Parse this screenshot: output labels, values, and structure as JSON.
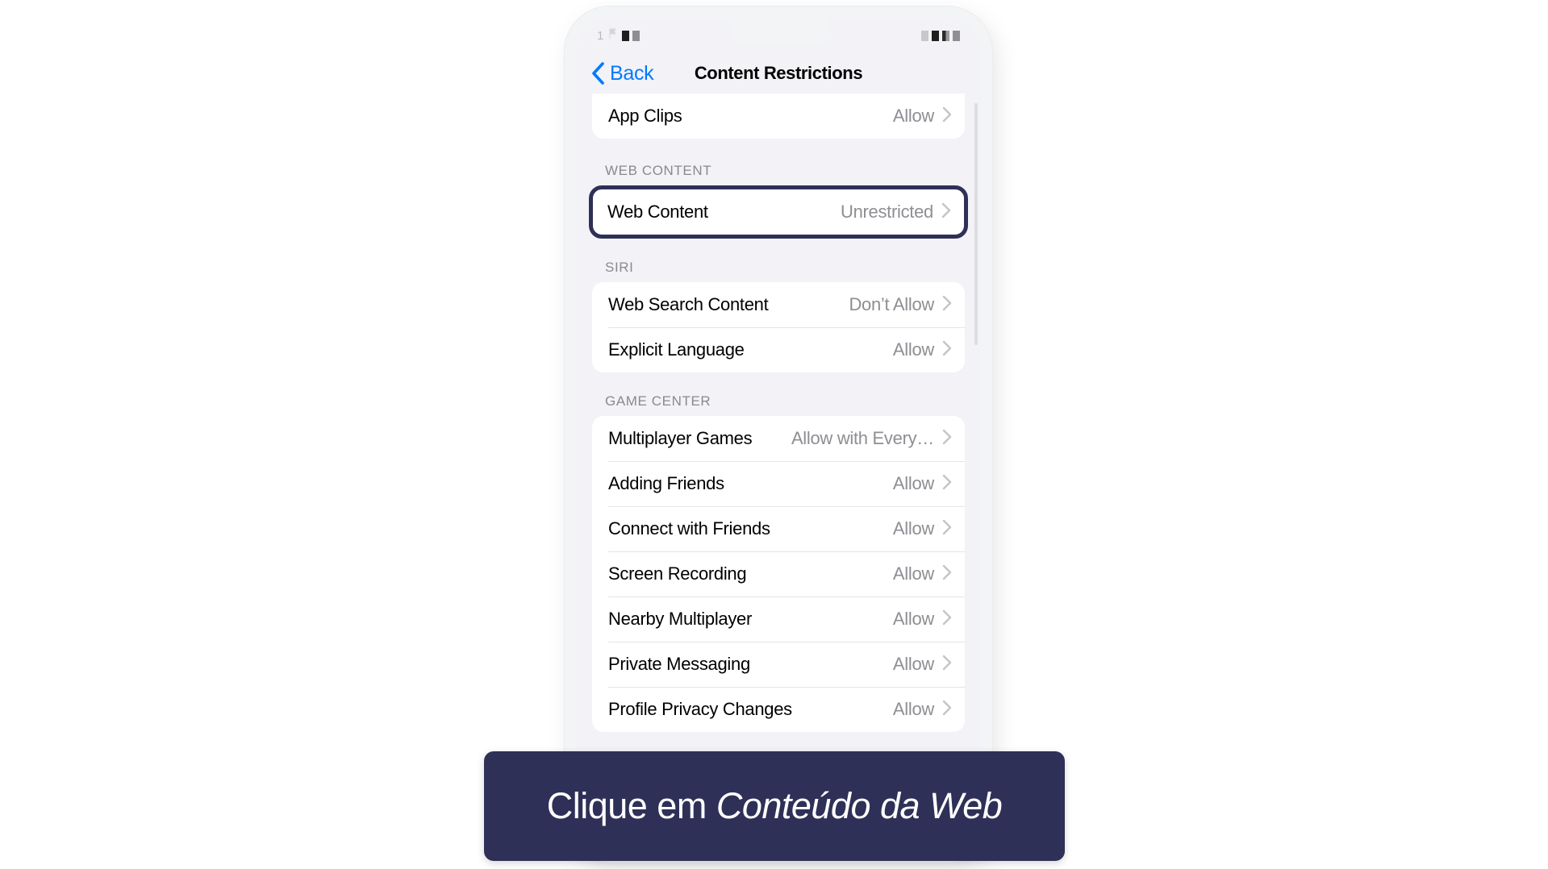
{
  "app": {
    "platform": "ios-settings",
    "accent_color": "#007aff",
    "highlight_color": "#2f3057",
    "screen_background": "#f2f2f7",
    "card_background": "#ffffff",
    "secondary_text_color": "#8e8e93"
  },
  "status_bar": {
    "left_text": "1",
    "left_icons": [
      "flag-icon",
      "pixelated-icon",
      "pixelated-icon"
    ],
    "right_icons": [
      "pixelated-icon",
      "pixelated-icon",
      "pixelated-icon"
    ],
    "obscured": "true"
  },
  "nav": {
    "back_label": "Back",
    "title": "Content Restrictions",
    "back_icon": "chevron-left-icon"
  },
  "sections": [
    {
      "header": "",
      "clipped_top": true,
      "rows": [
        {
          "label": "App Clips",
          "value": "Allow",
          "accessory": "chevron-right-icon"
        }
      ]
    },
    {
      "header": "WEB CONTENT",
      "highlighted": true,
      "rows": [
        {
          "label": "Web Content",
          "value": "Unrestricted",
          "accessory": "chevron-right-icon"
        }
      ]
    },
    {
      "header": "SIRI",
      "rows": [
        {
          "label": "Web Search Content",
          "value": "Don’t Allow",
          "accessory": "chevron-right-icon"
        },
        {
          "label": "Explicit Language",
          "value": "Allow",
          "accessory": "chevron-right-icon"
        }
      ]
    },
    {
      "header": "GAME CENTER",
      "rows": [
        {
          "label": "Multiplayer Games",
          "value": "Allow with Every…",
          "accessory": "chevron-right-icon"
        },
        {
          "label": "Adding Friends",
          "value": "Allow",
          "accessory": "chevron-right-icon"
        },
        {
          "label": "Connect with Friends",
          "value": "Allow",
          "accessory": "chevron-right-icon"
        },
        {
          "label": "Screen Recording",
          "value": "Allow",
          "accessory": "chevron-right-icon"
        },
        {
          "label": "Nearby Multiplayer",
          "value": "Allow",
          "accessory": "chevron-right-icon"
        },
        {
          "label": "Private Messaging",
          "value": "Allow",
          "accessory": "chevron-right-icon"
        },
        {
          "label": "Profile Privacy Changes",
          "value": "Allow",
          "accessory": "chevron-right-icon"
        }
      ]
    }
  ],
  "caption": {
    "prefix": "Clique em ",
    "emphasis": "Conteúdo da Web",
    "full_text": "Clique em Conteúdo da Web"
  }
}
